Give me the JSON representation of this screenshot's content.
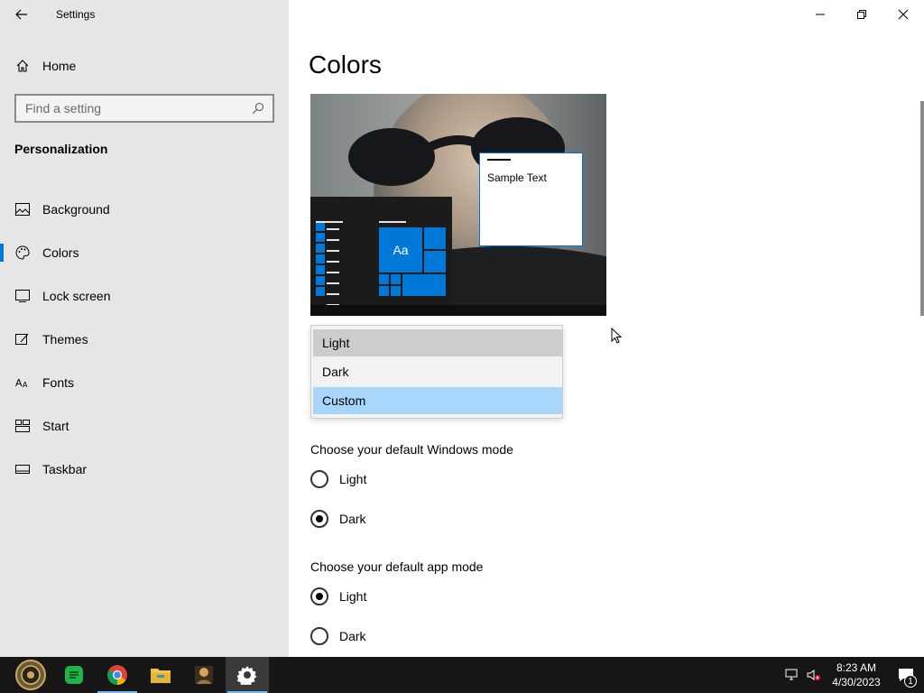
{
  "window": {
    "title": "Settings",
    "back_icon": "back-arrow-icon",
    "controls": [
      "minimize",
      "restore",
      "close"
    ]
  },
  "sidebar": {
    "home_label": "Home",
    "search_placeholder": "Find a setting",
    "section": "Personalization",
    "items": [
      {
        "label": "Background",
        "icon": "picture-icon",
        "selected": false
      },
      {
        "label": "Colors",
        "icon": "palette-icon",
        "selected": true
      },
      {
        "label": "Lock screen",
        "icon": "lock-screen-icon",
        "selected": false
      },
      {
        "label": "Themes",
        "icon": "themes-icon",
        "selected": false
      },
      {
        "label": "Fonts",
        "icon": "fonts-icon",
        "selected": false
      },
      {
        "label": "Start",
        "icon": "start-icon",
        "selected": false
      },
      {
        "label": "Taskbar",
        "icon": "taskbar-icon",
        "selected": false
      }
    ]
  },
  "main": {
    "title": "Colors",
    "preview": {
      "sample_text": "Sample Text",
      "tile_text": "Aa",
      "accent_color": "#0078d7"
    },
    "color_dropdown": {
      "options": [
        "Light",
        "Dark",
        "Custom"
      ],
      "hovered": "Light",
      "selected": "Custom"
    },
    "windows_mode": {
      "heading": "Choose your default Windows mode",
      "options": [
        "Light",
        "Dark"
      ],
      "selected": "Dark"
    },
    "app_mode": {
      "heading": "Choose your default app mode",
      "options": [
        "Light",
        "Dark"
      ],
      "selected": "Light"
    }
  },
  "taskbar": {
    "apps": [
      {
        "name": "start-app-icon",
        "active": false
      },
      {
        "name": "spreadsheet-app-icon",
        "active": false
      },
      {
        "name": "chrome-icon",
        "active": false
      },
      {
        "name": "file-explorer-icon",
        "active": false
      },
      {
        "name": "image-app-icon",
        "active": false
      },
      {
        "name": "settings-gear-icon",
        "active": true
      }
    ],
    "time": "8:23 AM",
    "date": "4/30/2023",
    "notification_count": "1"
  }
}
